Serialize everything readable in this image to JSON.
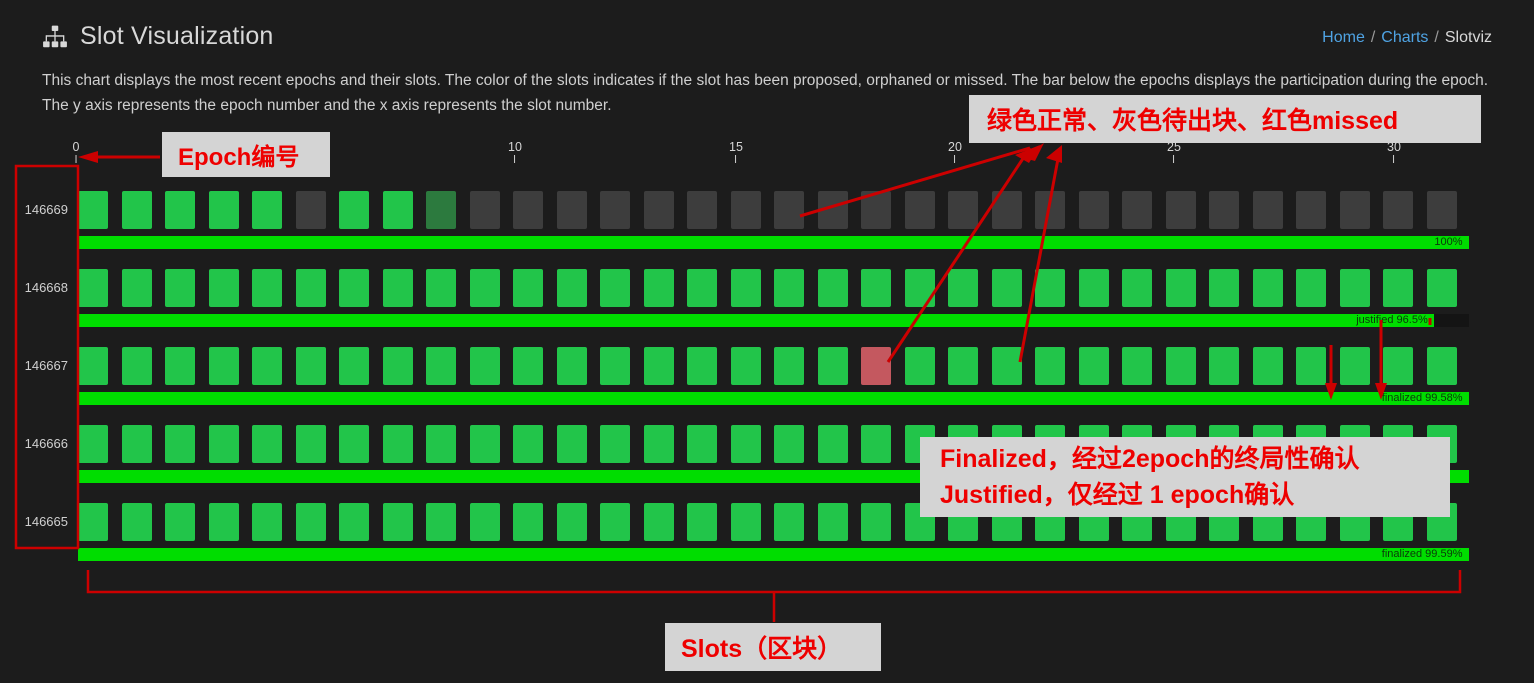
{
  "header": {
    "title": "Slot Visualization",
    "icon": "sitemap-icon",
    "breadcrumb": {
      "home": "Home",
      "charts": "Charts",
      "current": "Slotviz",
      "separator": "/"
    }
  },
  "description": "This chart displays the most recent epochs and their slots. The color of the slots indicates if the slot has been proposed, orphaned or missed. The bar below the epochs displays the participation during the epoch. The y axis represents the epoch number and the x axis represents the slot number.",
  "colors": {
    "background": "#1c1c1c",
    "proposed": "#22c54a",
    "scheduled": "#3d3d3d",
    "missed": "#c4585f",
    "orphaned": "#2c7a3e",
    "participation_bar": "#00dd00",
    "link": "#4fa3e3",
    "annotation": "#ee0000",
    "annotation_background": "#d4d4d4"
  },
  "chart_data": {
    "type": "heatmap",
    "title": "Slot Visualization",
    "xlabel": "slot number",
    "ylabel": "epoch number",
    "x_ticks": [
      {
        "label": "0",
        "x": 76
      },
      {
        "label": "10",
        "x": 515
      },
      {
        "label": "15",
        "x": 736
      },
      {
        "label": "20",
        "x": 955
      },
      {
        "label": "25",
        "x": 1174
      },
      {
        "label": "30",
        "x": 1394
      }
    ],
    "slot_states": [
      "proposed",
      "scheduled",
      "missed",
      "orphaned"
    ],
    "epochs": [
      {
        "epoch": "146669",
        "participation_label": "100%",
        "participation_percent": 100,
        "bar_width_pct": 100,
        "slots": [
          "proposed",
          "proposed",
          "proposed",
          "proposed",
          "proposed",
          "scheduled",
          "proposed",
          "proposed",
          "orphaned",
          "scheduled",
          "scheduled",
          "scheduled",
          "scheduled",
          "scheduled",
          "scheduled",
          "scheduled",
          "scheduled",
          "scheduled",
          "scheduled",
          "scheduled",
          "scheduled",
          "scheduled",
          "scheduled",
          "scheduled",
          "scheduled",
          "scheduled",
          "scheduled",
          "scheduled",
          "scheduled",
          "scheduled",
          "scheduled",
          "scheduled"
        ]
      },
      {
        "epoch": "146668",
        "participation_label": "justified 96.5%",
        "participation_percent": 96.5,
        "bar_width_pct": 97.5,
        "slots": [
          "proposed",
          "proposed",
          "proposed",
          "proposed",
          "proposed",
          "proposed",
          "proposed",
          "proposed",
          "proposed",
          "proposed",
          "proposed",
          "proposed",
          "proposed",
          "proposed",
          "proposed",
          "proposed",
          "proposed",
          "proposed",
          "proposed",
          "proposed",
          "proposed",
          "proposed",
          "proposed",
          "proposed",
          "proposed",
          "proposed",
          "proposed",
          "proposed",
          "proposed",
          "proposed",
          "proposed",
          "proposed"
        ]
      },
      {
        "epoch": "146667",
        "participation_label": "finalized 99.58%",
        "participation_percent": 99.58,
        "bar_width_pct": 100,
        "slots": [
          "proposed",
          "proposed",
          "proposed",
          "proposed",
          "proposed",
          "proposed",
          "proposed",
          "proposed",
          "proposed",
          "proposed",
          "proposed",
          "proposed",
          "proposed",
          "proposed",
          "proposed",
          "proposed",
          "proposed",
          "proposed",
          "missed",
          "proposed",
          "proposed",
          "proposed",
          "proposed",
          "proposed",
          "proposed",
          "proposed",
          "proposed",
          "proposed",
          "proposed",
          "proposed",
          "proposed",
          "proposed"
        ]
      },
      {
        "epoch": "146666",
        "participation_label": "",
        "participation_percent": 99.6,
        "bar_width_pct": 100,
        "slots": [
          "proposed",
          "proposed",
          "proposed",
          "proposed",
          "proposed",
          "proposed",
          "proposed",
          "proposed",
          "proposed",
          "proposed",
          "proposed",
          "proposed",
          "proposed",
          "proposed",
          "proposed",
          "proposed",
          "proposed",
          "proposed",
          "proposed",
          "proposed",
          "proposed",
          "proposed",
          "proposed",
          "proposed",
          "proposed",
          "proposed",
          "proposed",
          "proposed",
          "proposed",
          "proposed",
          "proposed",
          "proposed"
        ]
      },
      {
        "epoch": "146665",
        "participation_label": "finalized 99.59%",
        "participation_percent": 99.59,
        "bar_width_pct": 100,
        "slots": [
          "proposed",
          "proposed",
          "proposed",
          "proposed",
          "proposed",
          "proposed",
          "proposed",
          "proposed",
          "proposed",
          "proposed",
          "proposed",
          "proposed",
          "proposed",
          "proposed",
          "proposed",
          "proposed",
          "proposed",
          "proposed",
          "proposed",
          "proposed",
          "proposed",
          "proposed",
          "proposed",
          "proposed",
          "proposed",
          "proposed",
          "proposed",
          "proposed",
          "proposed",
          "proposed",
          "proposed",
          "proposed"
        ]
      }
    ]
  },
  "annotations": {
    "legend": "绿色正常、灰色待出块、红色missed",
    "epoch_label": "Epoch编号",
    "finality_line1": "Finalized，经过2epoch的终局性确认",
    "finality_line2": "Justified，仅经过 1 epoch确认",
    "slots_label": "Slots（区块）"
  }
}
